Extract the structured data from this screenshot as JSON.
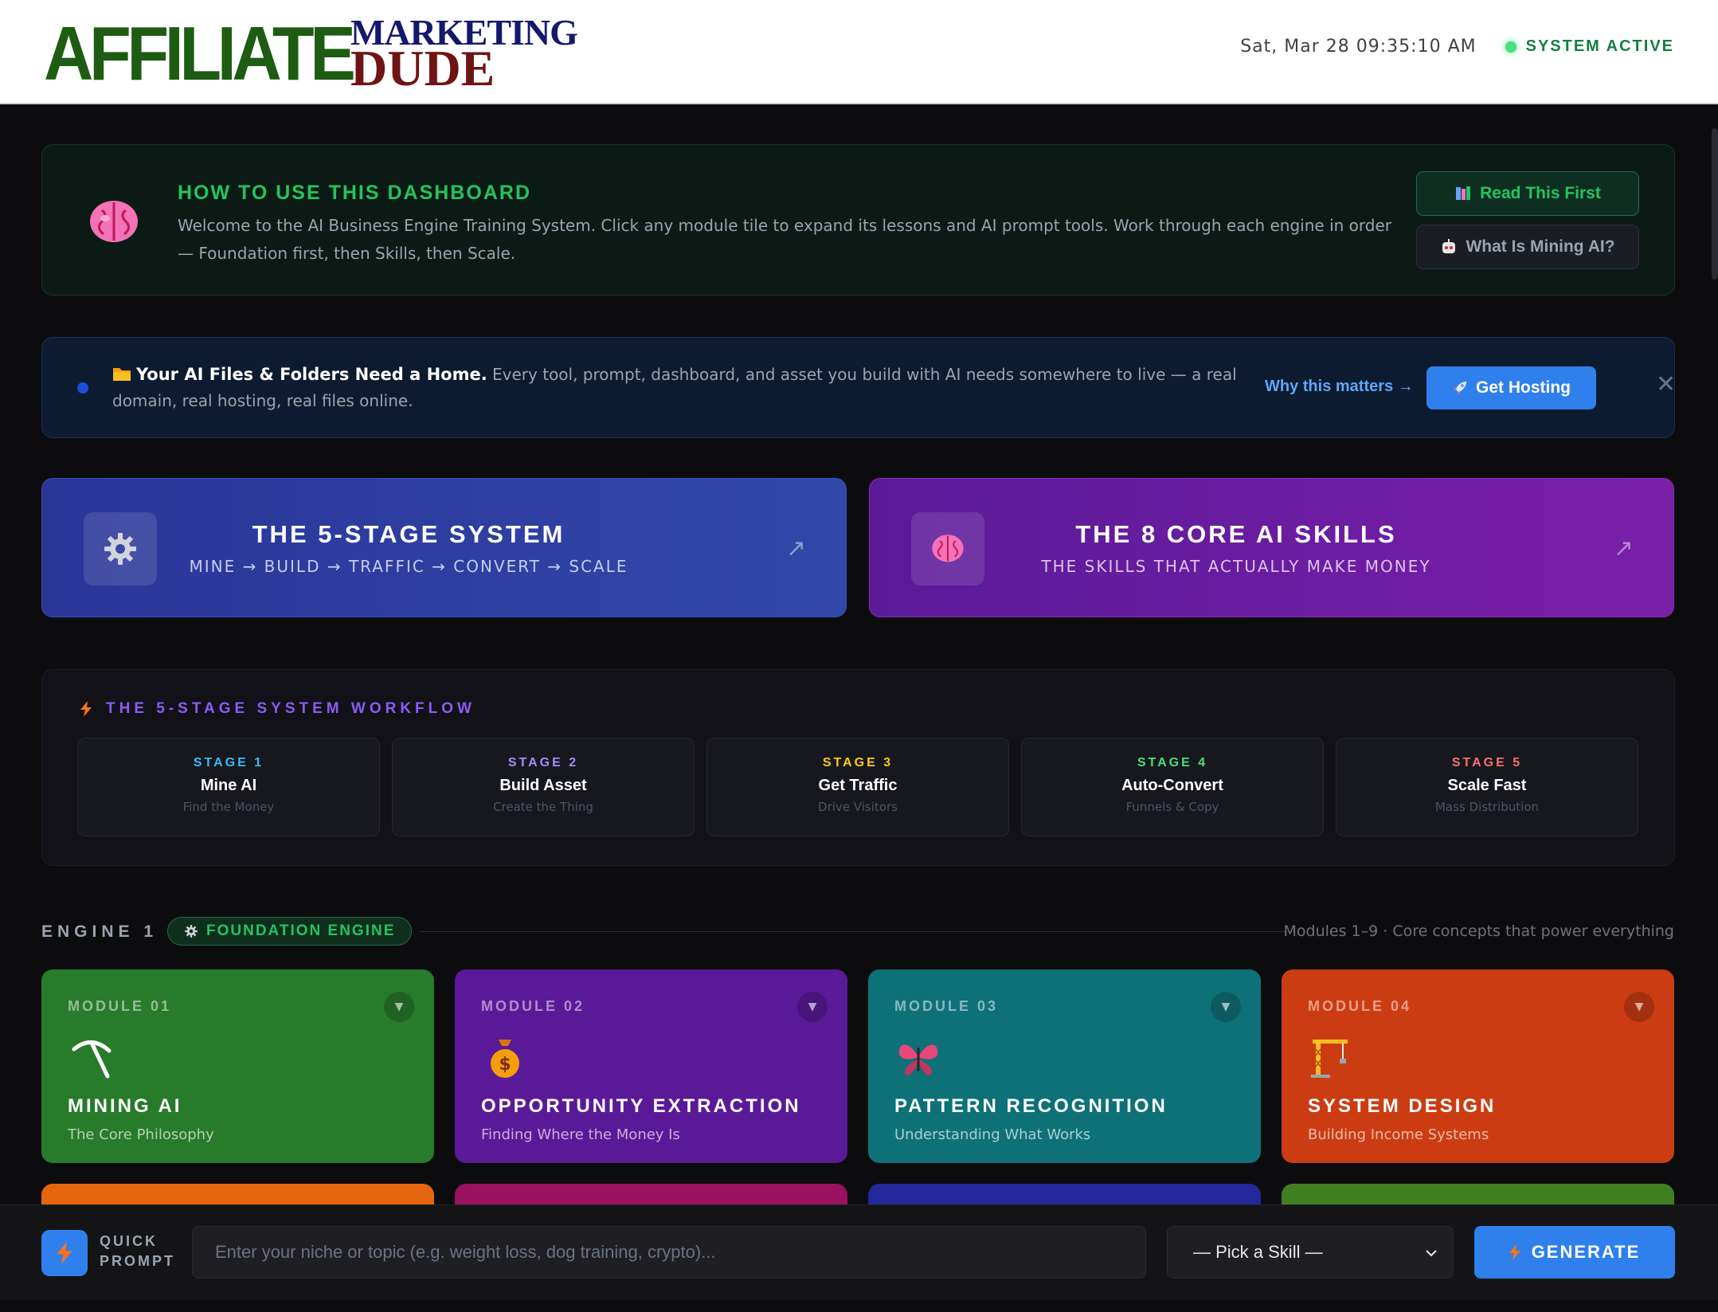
{
  "header": {
    "logo_main": "AFFILIATE",
    "logo_sub_top": "MARKETING",
    "logo_sub_bottom": "DUDE",
    "datetime": "Sat, Mar 28 09:35:10 AM",
    "status": "SYSTEM ACTIVE"
  },
  "howto": {
    "title": "HOW TO USE THIS DASHBOARD",
    "text": "Welcome to the AI Business Engine Training System. Click any module tile to expand its lessons and AI prompt tools. Work through each engine in order — Foundation first, then Skills, then Scale.",
    "read_label": "Read This First",
    "what_label": "What Is Mining AI?",
    "icon": "brain-icon"
  },
  "hosting": {
    "bold": "Your AI Files & Folders Need a Home.",
    "text": " Every tool, prompt, dashboard, and asset you build with AI needs somewhere to live — a real domain, real hosting, real files online.",
    "why_label": "Why this matters →",
    "button_label": "Get Hosting"
  },
  "cards": [
    {
      "title": "THE 5-STAGE SYSTEM",
      "subtitle": "MINE → BUILD → TRAFFIC → CONVERT → SCALE",
      "icon": "gear-icon"
    },
    {
      "title": "THE 8 CORE AI SKILLS",
      "subtitle": "THE SKILLS THAT ACTUALLY MAKE MONEY",
      "icon": "brain-icon"
    }
  ],
  "workflow": {
    "title": "THE 5-STAGE SYSTEM WORKFLOW",
    "stages": [
      {
        "num": "STAGE 1",
        "name": "Mine AI",
        "desc": "Find the Money",
        "color": "#38bdf8"
      },
      {
        "num": "STAGE 2",
        "name": "Build Asset",
        "desc": "Create the Thing",
        "color": "#a78bfa"
      },
      {
        "num": "STAGE 3",
        "name": "Get Traffic",
        "desc": "Drive Visitors",
        "color": "#facc15"
      },
      {
        "num": "STAGE 4",
        "name": "Auto-Convert",
        "desc": "Funnels & Copy",
        "color": "#4ade80"
      },
      {
        "num": "STAGE 5",
        "name": "Scale Fast",
        "desc": "Mass Distribution",
        "color": "#f87171"
      }
    ]
  },
  "engine": {
    "label": "ENGINE 1",
    "badge": "FOUNDATION ENGINE",
    "meta": "Modules 1–9 · Core concepts that power everything"
  },
  "modules": [
    {
      "num": "MODULE 01",
      "title": "MINING AI",
      "subtitle": "The Core Philosophy",
      "icon": "pickaxe-icon",
      "glyph": "⛏",
      "color": "#277b2b"
    },
    {
      "num": "MODULE 02",
      "title": "OPPORTUNITY EXTRACTION",
      "subtitle": "Finding Where the Money Is",
      "icon": "money-bag-icon",
      "glyph": "💰",
      "color": "#5a1a98"
    },
    {
      "num": "MODULE 03",
      "title": "PATTERN RECOGNITION",
      "subtitle": "Understanding What Works",
      "icon": "butterfly-icon",
      "glyph": "🦋",
      "color": "#0e7178"
    },
    {
      "num": "MODULE 04",
      "title": "SYSTEM DESIGN",
      "subtitle": "Building Income Systems",
      "icon": "crane-icon",
      "glyph": "🏗",
      "color": "#cc3c12"
    }
  ],
  "module_peek_colors": [
    "#e8650f",
    "#9a1160",
    "#22279a",
    "#3f7f1f"
  ],
  "quick_prompt": {
    "label_line1": "QUICK",
    "label_line2": "PROMPT",
    "placeholder": "Enter your niche or topic (e.g. weight loss, dog training, crypto)...",
    "select_value": "— Pick a Skill —",
    "generate_label": "GENERATE"
  }
}
